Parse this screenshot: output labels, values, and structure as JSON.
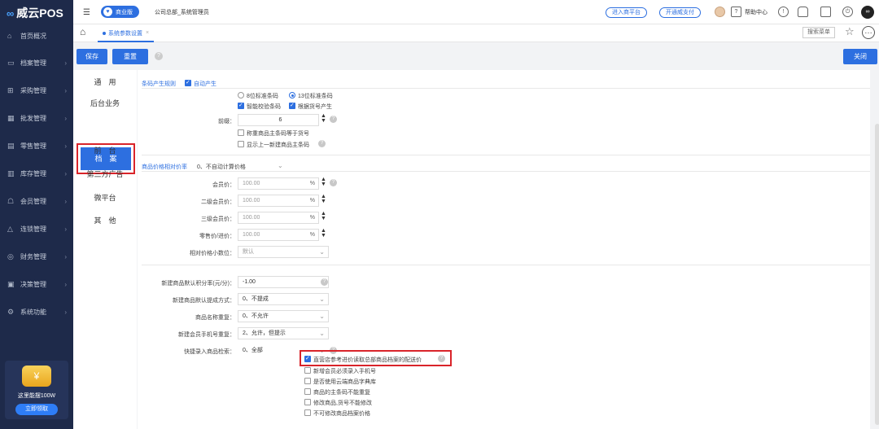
{
  "app": {
    "logo_text": "威云POS",
    "edition": "商业版",
    "breadcrumb": "公司总部_系统管理员"
  },
  "topbar": {
    "enter_store": "进入商平台",
    "open_pay": "开通威支付",
    "help": "帮助中心"
  },
  "sidebar": {
    "items": [
      {
        "label": "首页概况",
        "icon": "home-icon",
        "arrow": false
      },
      {
        "label": "档案管理",
        "icon": "archive-icon",
        "arrow": true
      },
      {
        "label": "采购管理",
        "icon": "cart-icon",
        "arrow": true
      },
      {
        "label": "批发管理",
        "icon": "wholesale-icon",
        "arrow": true
      },
      {
        "label": "零售管理",
        "icon": "retail-icon",
        "arrow": true
      },
      {
        "label": "库存管理",
        "icon": "inventory-icon",
        "arrow": true
      },
      {
        "label": "会员管理",
        "icon": "member-icon",
        "arrow": true
      },
      {
        "label": "连锁管理",
        "icon": "chain-icon",
        "arrow": true
      },
      {
        "label": "财务管理",
        "icon": "finance-icon",
        "arrow": true
      },
      {
        "label": "决策管理",
        "icon": "decision-icon",
        "arrow": true
      },
      {
        "label": "系统功能",
        "icon": "system-icon",
        "arrow": true
      }
    ],
    "promo": {
      "text": "这里能摆100W",
      "button": "立即领取"
    }
  },
  "tabs": {
    "active": "系统参数设置",
    "search_menu": "搜索菜单"
  },
  "toolbar": {
    "save": "保存",
    "reset": "重置",
    "close": "关闭"
  },
  "settings_nav": {
    "items": [
      "通　用",
      "后台业务",
      "档　案",
      "前　台",
      "第三方广告",
      "微平台",
      "其　他"
    ],
    "active_index": 2
  },
  "barcode": {
    "title": "条码产生规则",
    "auto_label": "自动产生",
    "auto_checked": true,
    "opt_8": "8位标准条码",
    "opt_13": "13位标准条码",
    "selected": "13",
    "smart_check": "智能校验条码",
    "by_item_no": "根据货号产生",
    "prefix_label": "前缀：",
    "prefix_value": "6",
    "scale_barcode": "称重商品主条码等于货号",
    "show_last": "显示上一新建商品主条码"
  },
  "price": {
    "title": "商品价格相对价率",
    "mode": "0、不自动计算价格",
    "rows": [
      {
        "label": "会员价：",
        "value": "100.00",
        "unit": "%"
      },
      {
        "label": "二级会员价：",
        "value": "100.00",
        "unit": "%"
      },
      {
        "label": "三级会员价：",
        "value": "100.00",
        "unit": "%"
      },
      {
        "label": "零售价/进价：",
        "value": "100.00",
        "unit": "%"
      }
    ],
    "decimal_label": "相对价格小数位：",
    "decimal_value": "默认"
  },
  "misc": {
    "rows": [
      {
        "label": "新建商品默认积分率(元/分)：",
        "value": "-1.00"
      },
      {
        "label": "新建商品默认提成方式：",
        "value": "0、不提成"
      },
      {
        "label": "商品名称重复：",
        "value": "0、不允许"
      },
      {
        "label": "新建会员手机号重复：",
        "value": "2、允许，但提示"
      },
      {
        "label": "快捷录入商品检索：",
        "value": "0、全部"
      }
    ],
    "checks": [
      {
        "label": "直营店参考进价读取总部商品档案的配送价",
        "checked": true
      },
      {
        "label": "新增会员必须录入手机号",
        "checked": false
      },
      {
        "label": "是否使用云端商品字典库",
        "checked": false
      },
      {
        "label": "商品的主条码不能重复",
        "checked": false
      },
      {
        "label": "修改商品,货号不能修改",
        "checked": false
      },
      {
        "label": "不可修改商品档案价格",
        "checked": false
      }
    ]
  },
  "colors": {
    "primary": "#2d6fe0",
    "sidebar": "#1e2a4a",
    "highlight": "#d9242a"
  }
}
